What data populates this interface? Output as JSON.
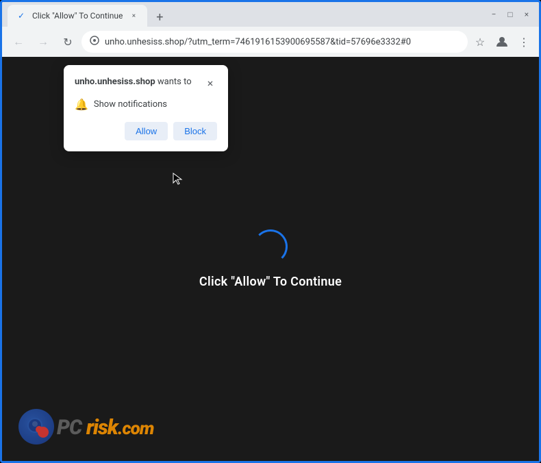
{
  "browser": {
    "title": "Click \"Allow\" To Continue",
    "tab_label": "Click \"Allow\" To Continue",
    "url": "unho.unhesiss.shop/?utm_term=7461916153900695587&tid=57696e3332#0",
    "new_tab_icon": "+",
    "minimize_label": "−",
    "maximize_label": "□",
    "close_label": "×"
  },
  "popup": {
    "title_text": " wants to",
    "title_bold": "unho.unhesiss.shop",
    "close_label": "×",
    "notification_label": "Show notifications",
    "allow_label": "Allow",
    "block_label": "Block"
  },
  "page": {
    "message": "Click \"Allow\" To Continue"
  },
  "pcrisk": {
    "pc_text": "PC",
    "risk_text": "risk",
    "com_text": ".com"
  }
}
